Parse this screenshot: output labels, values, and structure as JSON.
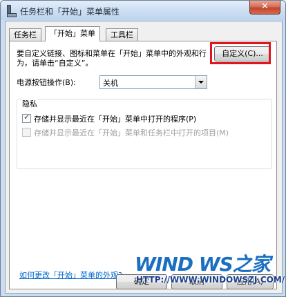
{
  "window": {
    "title": "任务栏和「开始」菜单属性",
    "close_label": "✕"
  },
  "tabs": [
    {
      "label": "任务栏",
      "active": false
    },
    {
      "label": "「开始」菜单",
      "active": true
    },
    {
      "label": "工具栏",
      "active": false
    }
  ],
  "panel": {
    "description": "要自定义链接、图标和菜单在「开始」菜单中的外观和行为，请单击“自定义”。",
    "customize_button": "自定义(C)...",
    "power_label": "电源按钮操作(B):",
    "power_value": "关机",
    "privacy_group_title": "隐私",
    "privacy_options": [
      {
        "label": "存储并显示最近在「开始」菜单中打开的程序(P)",
        "checked": true,
        "enabled": true
      },
      {
        "label": "存储并显示最近在「开始」菜单和任务栏中打开的项目(M)",
        "checked": false,
        "enabled": false
      }
    ],
    "help_link": "如何更改「开始」菜单的外观?"
  },
  "buttons": {
    "ok": "确定",
    "cancel": "取消",
    "apply": "应用(A)"
  },
  "watermark": {
    "logo": "WIND WS之家",
    "url": "HTTP://WWW.WINDOWSZJ.COM/"
  },
  "colors": {
    "highlight_border": "#e0141e",
    "link": "#0066cc",
    "watermark_blue": "#1a6fc2"
  }
}
